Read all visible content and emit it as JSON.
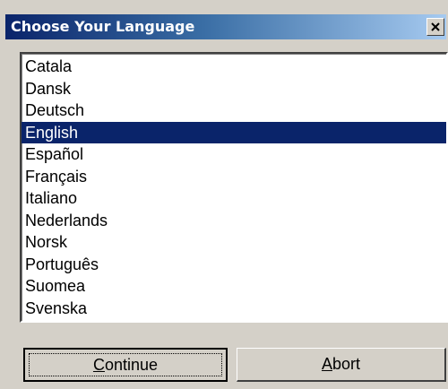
{
  "dialog": {
    "title": "Choose Your Language",
    "close_icon": "close-x-icon"
  },
  "languages": [
    "Catala",
    "Dansk",
    "Deutsch",
    "English",
    "Español",
    "Français",
    "Italiano",
    "Nederlands",
    "Norsk",
    "Português",
    "Suomea",
    "Svenska"
  ],
  "selected_language": "English",
  "buttons": {
    "continue": {
      "accel": "C",
      "rest": "ontinue"
    },
    "abort": {
      "accel": "A",
      "rest": "bort"
    }
  },
  "colors": {
    "selection": "#0a246a",
    "title_gradient_start": "#0a246a",
    "title_gradient_end": "#a6caf0",
    "face": "#d4d0c8"
  }
}
